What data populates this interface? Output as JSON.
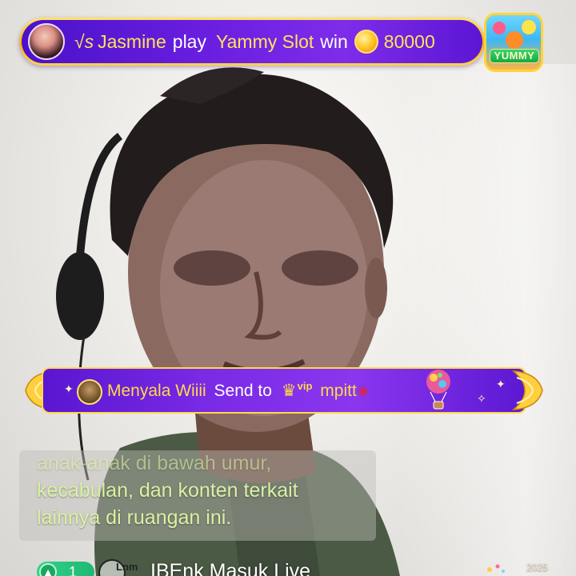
{
  "top_banner": {
    "prefix": "√s",
    "username": "Jasmine",
    "action": "play",
    "game": "Yammy Slot",
    "result": "win",
    "amount": "80000"
  },
  "game_logo": {
    "label": "YUMMY"
  },
  "gift_banner": {
    "sender": "Menyala Wiiii",
    "action": "Send to",
    "crown": "♛",
    "vip_label": "vip",
    "receiver": "mpitt",
    "gift_icon": "rose-icon"
  },
  "chat": {
    "lines": [
      "anak-anak di bawah umur,",
      "kecabulan, dan konten terkait",
      "lainnya di ruangan ini."
    ]
  },
  "join_notice": {
    "level": "1",
    "level_icon": "▲",
    "badge": "Lnm",
    "text": "IBEnk Masuk Live"
  },
  "corner_count": "2025",
  "colors": {
    "banner_purple": "#6a1ee0",
    "banner_gold": "#f4b21d",
    "highlight_yellow": "#ffe35c",
    "chat_text": "#d9f2a2",
    "level_green": "#2fd28a"
  }
}
